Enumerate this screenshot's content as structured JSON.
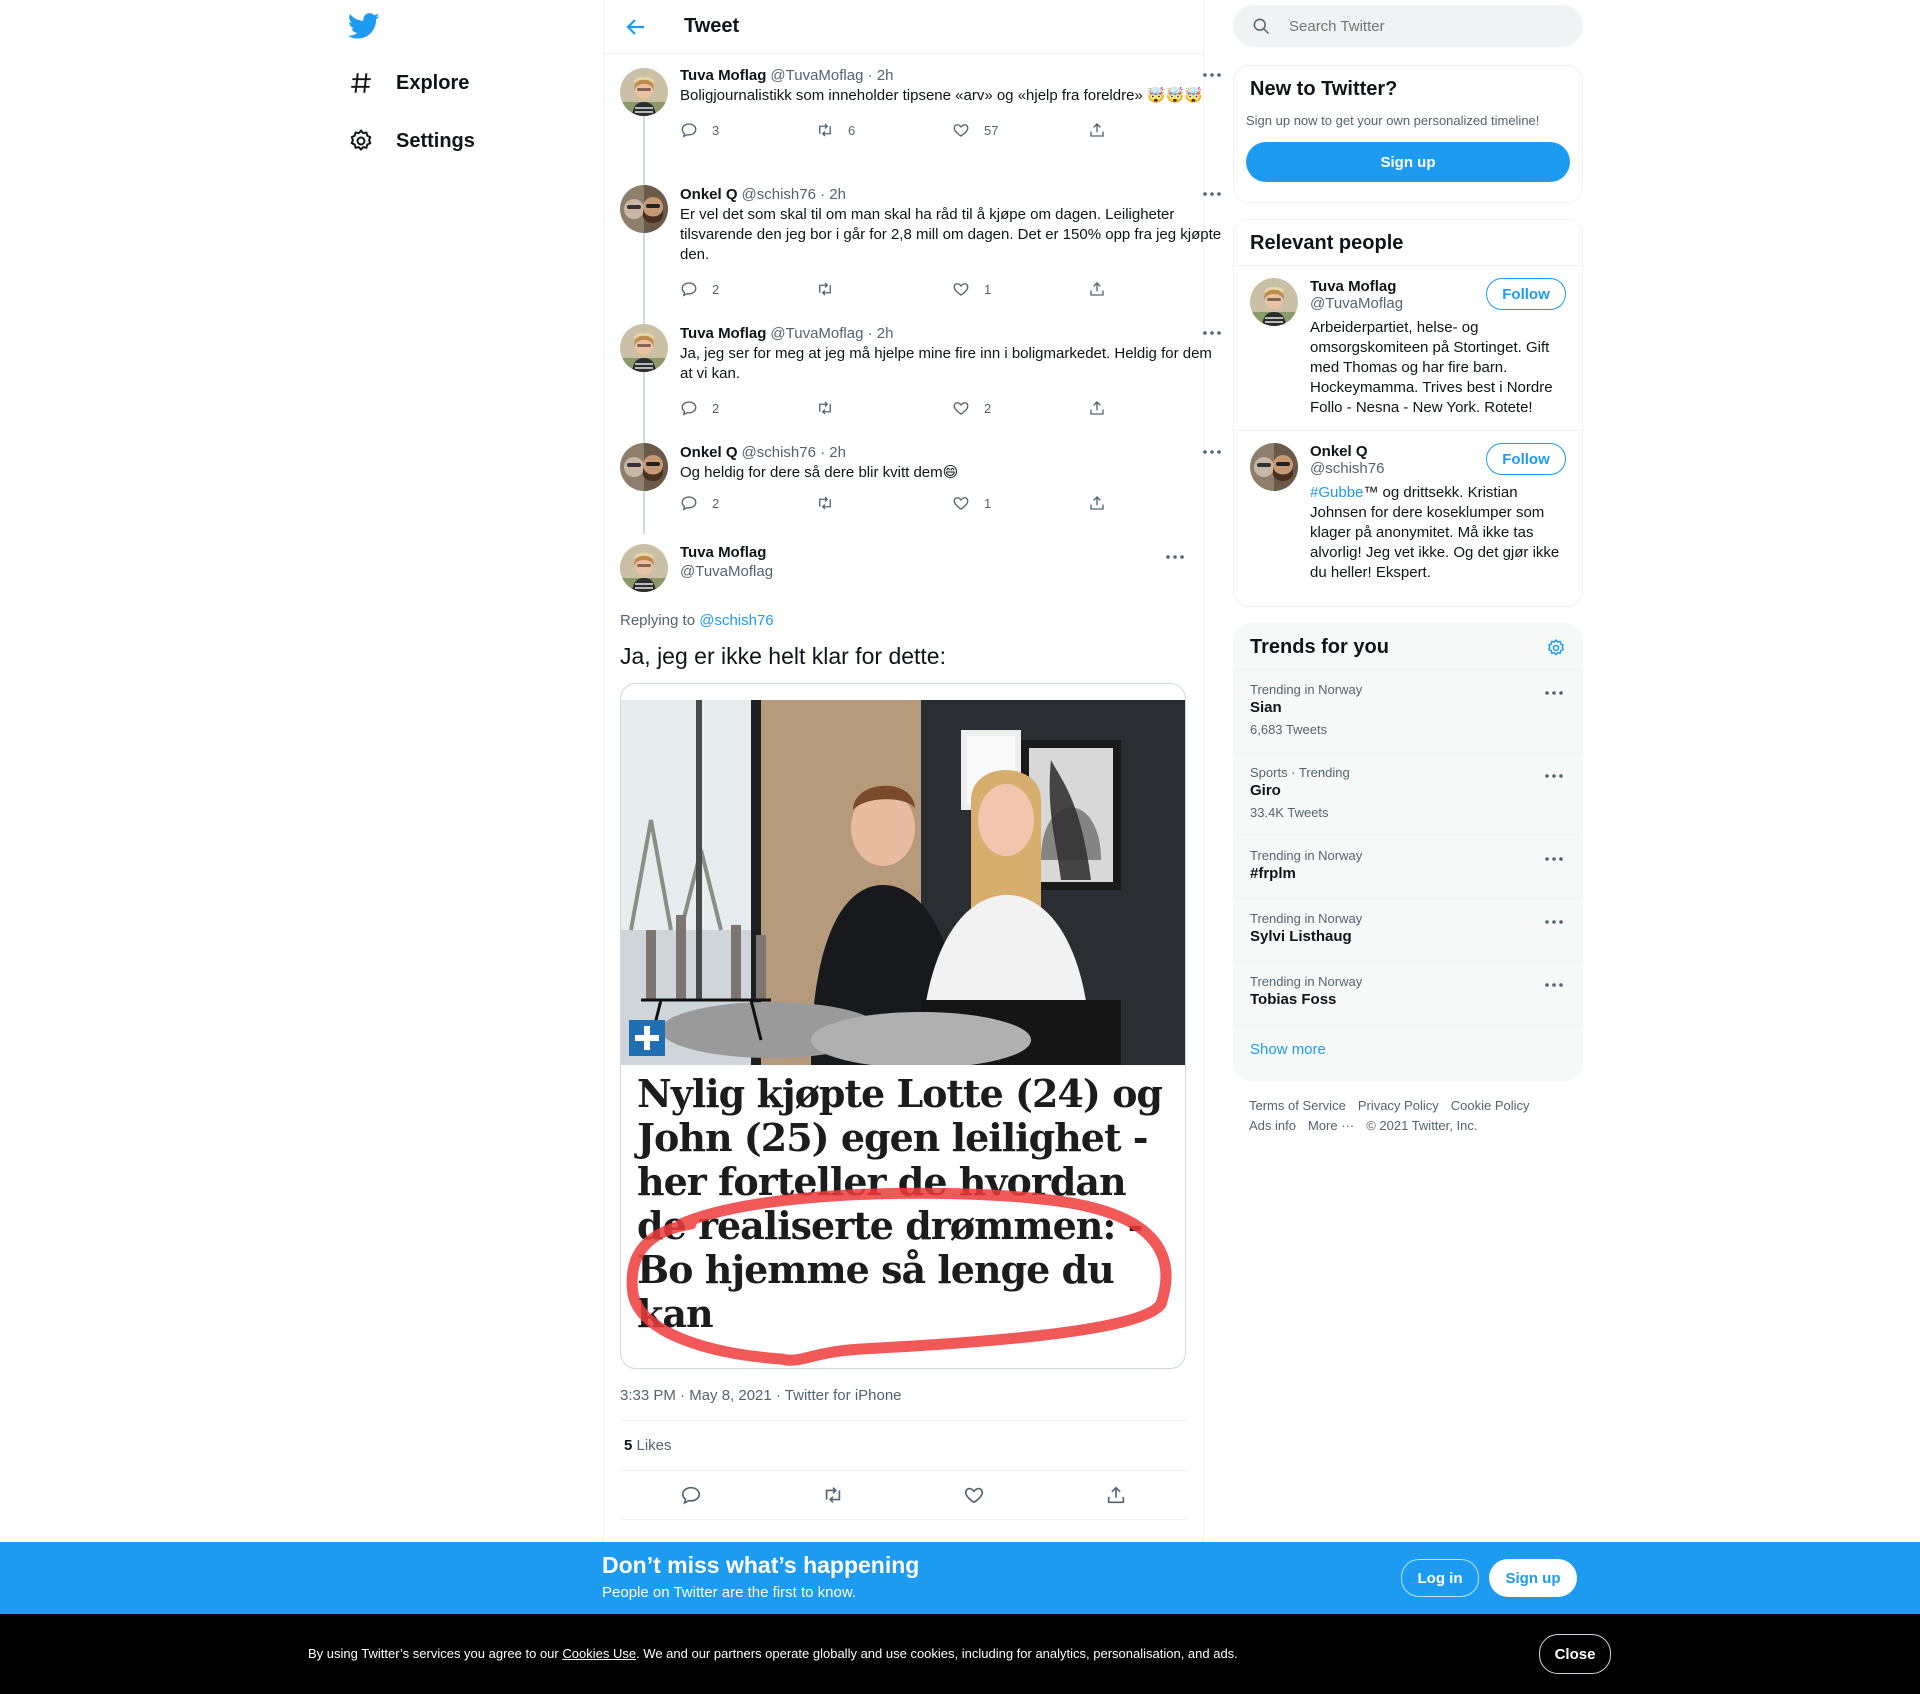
{
  "nav": {
    "logo": "twitter-bird-icon",
    "items": [
      {
        "label": "Explore",
        "icon": "hashtag-icon"
      },
      {
        "label": "Settings",
        "icon": "gear-icon"
      }
    ]
  },
  "header": {
    "title": "Tweet"
  },
  "thread": [
    {
      "name": "Tuva Moflag",
      "handle": "@TuvaMoflag",
      "time": "· 2h",
      "text": "Boligjournalistikk som inneholder tipsene «arv» og «hjelp fra foreldre» 🤯🤯🤯",
      "replies": "3",
      "retweets": "6",
      "likes": "57"
    },
    {
      "name": "Onkel Q",
      "handle": "@schish76",
      "time": "· 2h",
      "text": "Er vel det som skal til om man skal ha råd til å kjøpe om dagen. Leiligheter tilsvarende den jeg bor i går for 2,8 mill om dagen. Det er 150% opp fra jeg kjøpte den.",
      "replies": "2",
      "retweets": "",
      "likes": "1"
    },
    {
      "name": "Tuva Moflag",
      "handle": "@TuvaMoflag",
      "time": "· 2h",
      "text": "Ja, jeg ser for meg at jeg må hjelpe mine fire inn i boligmarkedet. Heldig for dem at vi kan.",
      "replies": "2",
      "retweets": "",
      "likes": "2"
    },
    {
      "name": "Onkel Q",
      "handle": "@schish76",
      "time": "· 2h",
      "text": "Og heldig for dere så dere blir kvitt dem😄",
      "replies": "2",
      "retweets": "",
      "likes": "1"
    }
  ],
  "focus": {
    "name": "Tuva Moflag",
    "handle": "@TuvaMoflag",
    "replying_prefix": "Replying to ",
    "replying_handle": "@schish76",
    "text": "Ja, jeg er ikke helt klar for dette:",
    "headline": "Nylig kjøpte Lotte (24) og John (25) egen leilighet - her forteller de hvordan de realiserte drømmen: - Bo hjemme så lenge du kan",
    "timestamp": "3:33 PM · May 8, 2021 · Twitter for iPhone",
    "likes_count": "5",
    "likes_label": " Likes"
  },
  "sidebar": {
    "search_placeholder": "Search Twitter",
    "new_title": "New to Twitter?",
    "new_sub": "Sign up now to get your own personalized timeline!",
    "signup": "Sign up",
    "relevant_title": "Relevant people",
    "people": [
      {
        "name": "Tuva Moflag",
        "handle": "@TuvaMoflag",
        "follow": "Follow",
        "bio": "Arbeiderpartiet, helse- og omsorgskomiteen på Stortinget. Gift med Thomas og har fire barn. Hockeymamma. Trives best i Nordre Follo - Nesna - New York. Rotete!"
      },
      {
        "name": "Onkel Q",
        "handle": "@schish76",
        "follow": "Follow",
        "bio_tag": "#Gubbe",
        "bio": "™ og drittsekk. Kristian Johnsen for dere koseklumper som klager på anonymitet. Må ikke tas alvorlig! Jeg vet ikke. Og det gjør ikke du heller! Ekspert."
      }
    ],
    "trends_title": "Trends for you",
    "trends": [
      {
        "context": "Trending in Norway",
        "name": "Sian",
        "count": "6,683 Tweets"
      },
      {
        "context": "Sports · Trending",
        "name": "Giro",
        "count": "33.4K Tweets"
      },
      {
        "context": "Trending in Norway",
        "name": "#frplm",
        "count": ""
      },
      {
        "context": "Trending in Norway",
        "name": "Sylvi Listhaug",
        "count": ""
      },
      {
        "context": "Trending in Norway",
        "name": "Tobias Foss",
        "count": ""
      }
    ],
    "show_more": "Show more",
    "footer": [
      "Terms of Service",
      "Privacy Policy",
      "Cookie Policy",
      "Ads info",
      "More ···",
      "© 2021 Twitter, Inc."
    ]
  },
  "bottom": {
    "title": "Don’t miss what’s happening",
    "sub": "People on Twitter are the first to know.",
    "login": "Log in",
    "signup": "Sign up"
  },
  "cookie": {
    "pre": "By using Twitter’s services you agree to our ",
    "link": "Cookies Use",
    "post": ". We and our partners operate globally and use cookies, including for analytics, personalisation, and ads.",
    "close": "Close"
  },
  "colors": {
    "accent": "#1d9bf0",
    "text": "#0f1419",
    "secondary": "#536471"
  }
}
